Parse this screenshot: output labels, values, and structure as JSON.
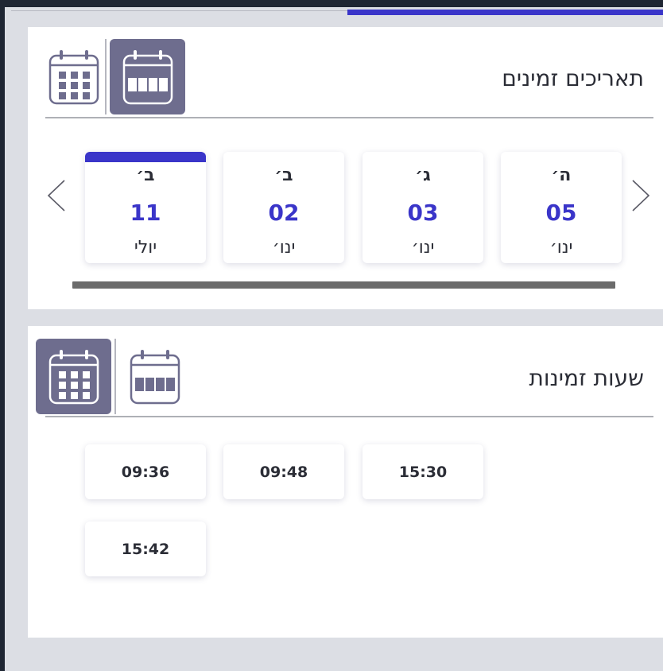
{
  "colors": {
    "accent": "#3a35c9",
    "active_toggle": "#6e6d8e",
    "background": "#dcdee4",
    "card": "#ffffff"
  },
  "progress": {
    "fraction": 0.48
  },
  "dates_section": {
    "title": "תאריכים זמינים",
    "view_toggle": {
      "grid_icon": "calendar-grid-icon",
      "week_icon": "calendar-week-icon",
      "active": "week"
    },
    "prev_icon": "chevron-left-icon",
    "next_icon": "chevron-right-icon",
    "dates": [
      {
        "dow": "ה׳",
        "day": "05",
        "month": "ינו׳",
        "selected": false
      },
      {
        "dow": "ג׳",
        "day": "03",
        "month": "ינו׳",
        "selected": false
      },
      {
        "dow": "ב׳",
        "day": "02",
        "month": "ינו׳",
        "selected": false
      },
      {
        "dow": "ב׳",
        "day": "11",
        "month": "יולי",
        "selected": true
      }
    ]
  },
  "times_section": {
    "title": "שעות זמינות",
    "view_toggle": {
      "grid_icon": "calendar-grid-icon",
      "week_icon": "calendar-week-icon",
      "active": "grid"
    },
    "times": [
      "15:30",
      "09:48",
      "09:36",
      "15:42"
    ]
  }
}
